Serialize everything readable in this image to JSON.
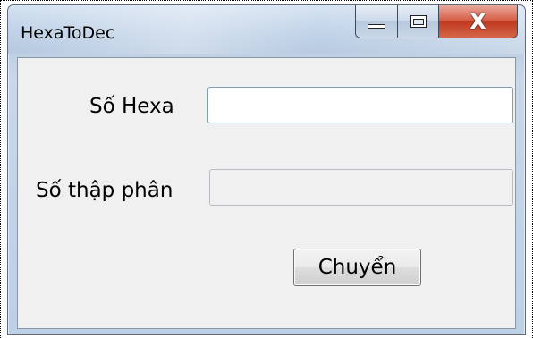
{
  "window": {
    "title": "HexaToDec",
    "caption_buttons": {
      "minimize_icon": "minimize-icon",
      "maximize_icon": "maximize-icon",
      "close_icon": "close-icon",
      "close_glyph": "X"
    }
  },
  "form": {
    "hexa_label": "Số Hexa",
    "hexa_value": "",
    "decimal_label": "Số thập phân",
    "decimal_value": "",
    "convert_button": "Chuyển"
  },
  "colors": {
    "close_button": "#c0391f",
    "client_background": "#f0f0f0",
    "frame": "#bcd0e6"
  }
}
